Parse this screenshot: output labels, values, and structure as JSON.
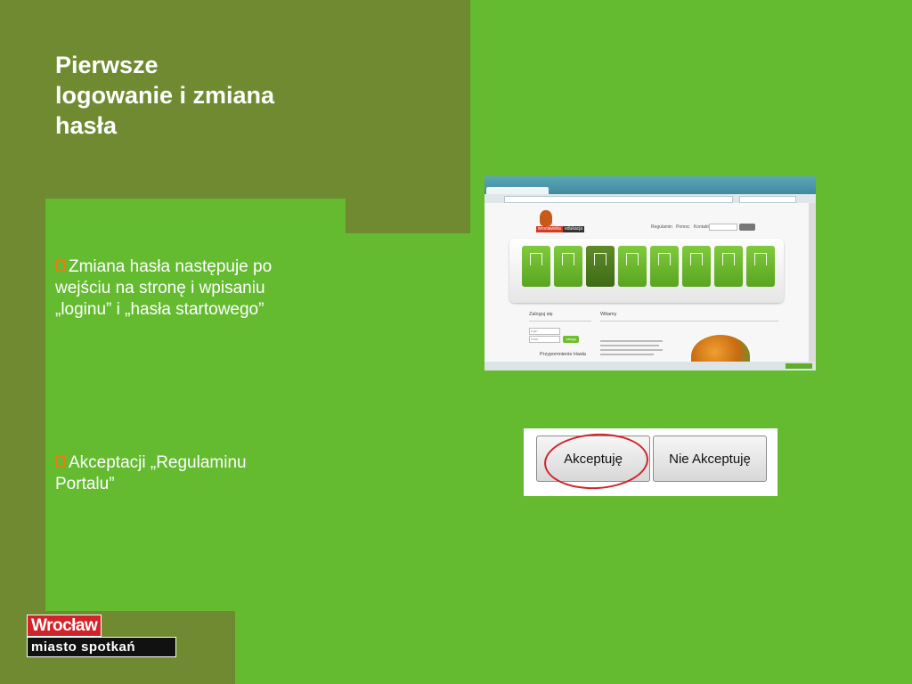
{
  "slide": {
    "title": "Pierwsze\nlogowanie i zmiana\nhasła",
    "bullets": [
      "Zmiana hasła następuje po\nwejściu na stronę i wpisaniu\n„loginu” i „hasła startowego”",
      "Akceptacji „Regulaminu\nPortalu”"
    ]
  },
  "browser_screenshot": {
    "logo_text_1": "wrocławska",
    "logo_text_2": "edukacja",
    "top_links": "Regulamin   Pomoc   Kontakt",
    "login_heading": "Zaloguj się",
    "welcome_heading": "Witamy",
    "login_placeholder": "login",
    "password_placeholder": "hasło",
    "login_button": "zaloguj",
    "reminder_heading": "Przypomnienie Hasła"
  },
  "accept_dialog": {
    "accept_label": "Akceptuję",
    "reject_label": "Nie Akceptuję"
  },
  "footer_logo": {
    "top_text": "Wrocław",
    "bottom_text": "miasto spotkań"
  },
  "colors": {
    "lime_green": "#64bb30",
    "olive_green": "#6f8a31",
    "bullet_orange": "#f07a10",
    "highlight_red": "#d2232a"
  }
}
